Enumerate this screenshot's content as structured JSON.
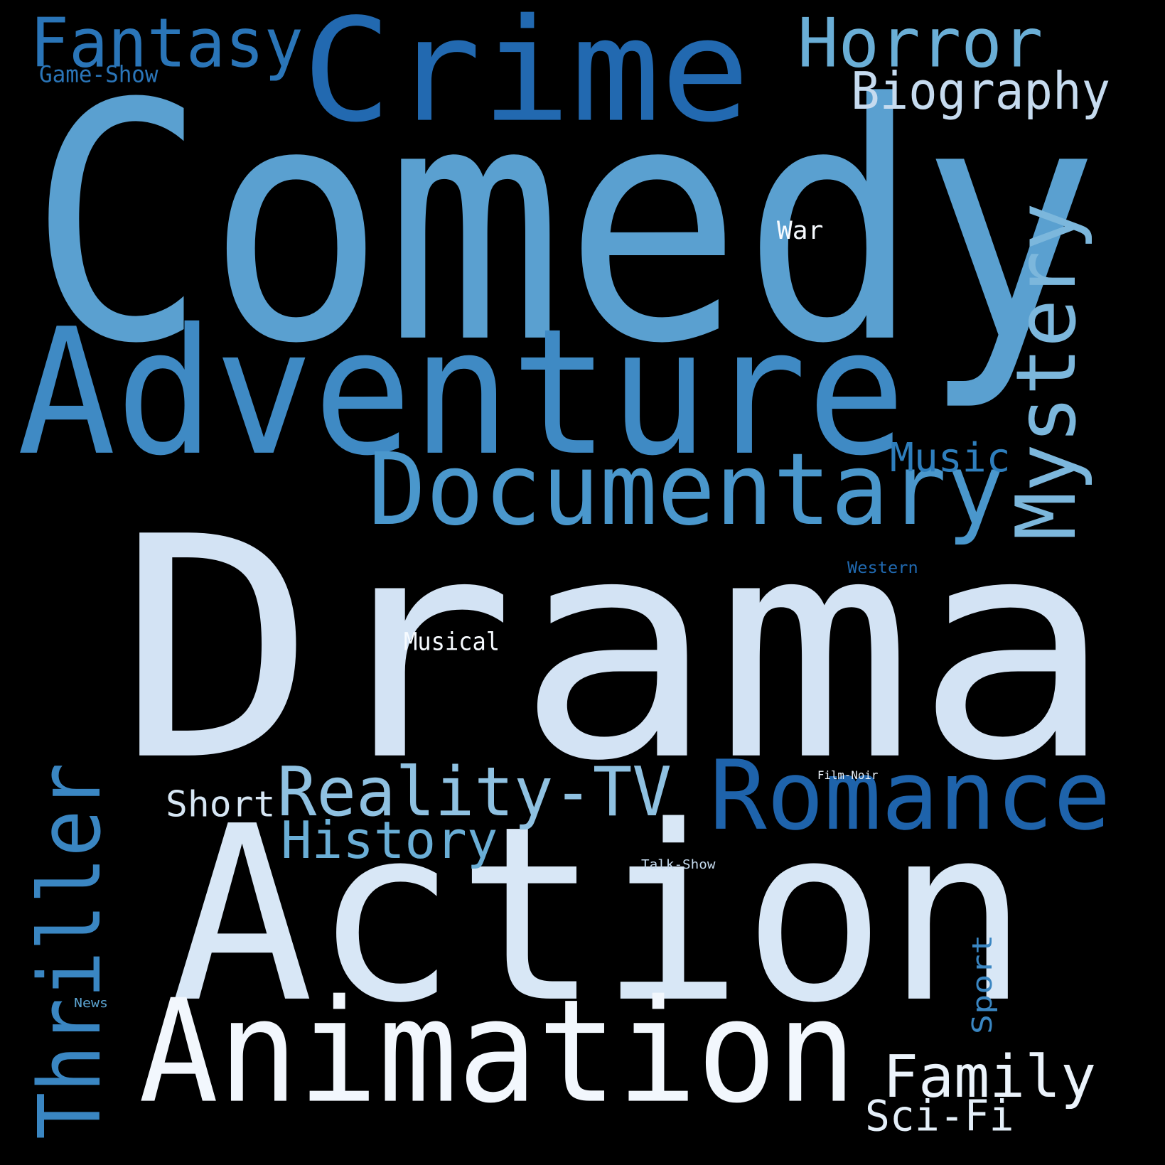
{
  "words": [
    {
      "key": "comedy",
      "text": "Comedy",
      "color": "#5aa0d0"
    },
    {
      "key": "drama",
      "text": "Drama",
      "color": "#d3e3f4"
    },
    {
      "key": "action",
      "text": "Action",
      "color": "#d8e7f6"
    },
    {
      "key": "adventure",
      "text": "Adventure",
      "color": "#3f8ac4"
    },
    {
      "key": "animation",
      "text": "Animation",
      "color": "#f2f7fd"
    },
    {
      "key": "crime",
      "text": "Crime",
      "color": "#2269b0"
    },
    {
      "key": "documentary",
      "text": "Documentary",
      "color": "#4a97cc"
    },
    {
      "key": "romance",
      "text": "Romance",
      "color": "#1e63ab"
    },
    {
      "key": "thriller",
      "text": "Thriller",
      "color": "#3a86c2"
    },
    {
      "key": "mystery",
      "text": "Mystery",
      "color": "#7cb7dc"
    },
    {
      "key": "reality_tv",
      "text": "Reality-TV",
      "color": "#8fc1e1"
    },
    {
      "key": "fantasy",
      "text": "Fantasy",
      "color": "#2a75b8"
    },
    {
      "key": "horror",
      "text": "Horror",
      "color": "#6aaed6"
    },
    {
      "key": "history",
      "text": "History",
      "color": "#6aaed6"
    },
    {
      "key": "biography",
      "text": "Biography",
      "color": "#c6dbef"
    },
    {
      "key": "family",
      "text": "Family",
      "color": "#ebf3fb"
    },
    {
      "key": "sci_fi",
      "text": "Sci-Fi",
      "color": "#e4eff9"
    },
    {
      "key": "music",
      "text": "Music",
      "color": "#2e7ebc"
    },
    {
      "key": "short",
      "text": "Short",
      "color": "#d6e6f4"
    },
    {
      "key": "sport",
      "text": "Sport",
      "color": "#3a86c2"
    },
    {
      "key": "war",
      "text": "War",
      "color": "#f7fbff"
    },
    {
      "key": "musical",
      "text": "Musical",
      "color": "#f7fbff"
    },
    {
      "key": "game_show",
      "text": "Game-Show",
      "color": "#2a75b8"
    },
    {
      "key": "western",
      "text": "Western",
      "color": "#2069b0"
    },
    {
      "key": "film_noir",
      "text": "Film-Noir",
      "color": "#eef5fc"
    },
    {
      "key": "talk_show",
      "text": "Talk-Show",
      "color": "#c6dbef"
    },
    {
      "key": "news",
      "text": "News",
      "color": "#5ba3d0"
    }
  ]
}
